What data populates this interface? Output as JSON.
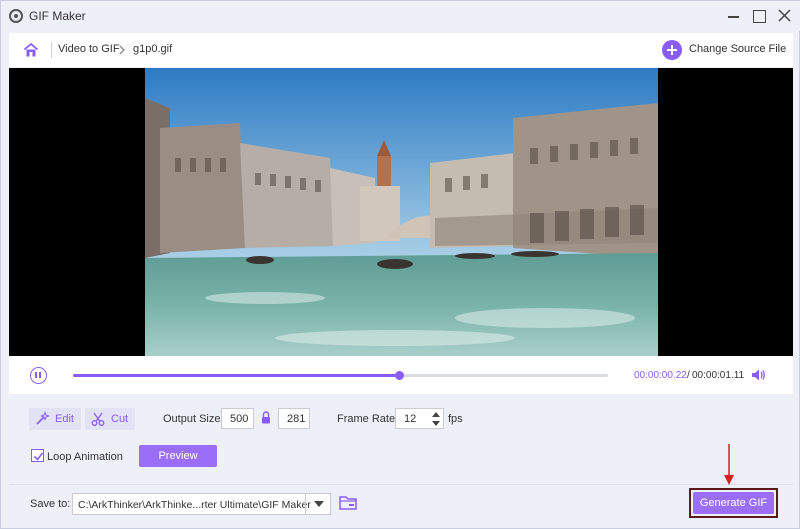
{
  "window": {
    "title": "GIF Maker"
  },
  "breadcrumb": {
    "parent": "Video to GIF",
    "current": "g1p0.gif"
  },
  "header": {
    "change_source_label": "Change Source File"
  },
  "player": {
    "progress": 0.61,
    "current_time": "00:00:00.22",
    "separator": "/",
    "total_time": "00:00:01.11"
  },
  "tools": {
    "edit_label": "Edit",
    "cut_label": "Cut"
  },
  "output": {
    "size_label": "Output Size:",
    "width": "500",
    "height": "281",
    "frame_rate_label": "Frame Rate:",
    "frame_rate": "12",
    "fps_label": "fps"
  },
  "loop": {
    "label": "Loop Animation",
    "checked": true
  },
  "buttons": {
    "preview": "Preview",
    "generate": "Generate GIF"
  },
  "save": {
    "label": "Save to:",
    "path": "C:\\ArkThinker\\ArkThinke...rter Ultimate\\GIF Maker"
  },
  "colors": {
    "accent": "#8a5cf6",
    "annotation": "#d81e1e"
  }
}
